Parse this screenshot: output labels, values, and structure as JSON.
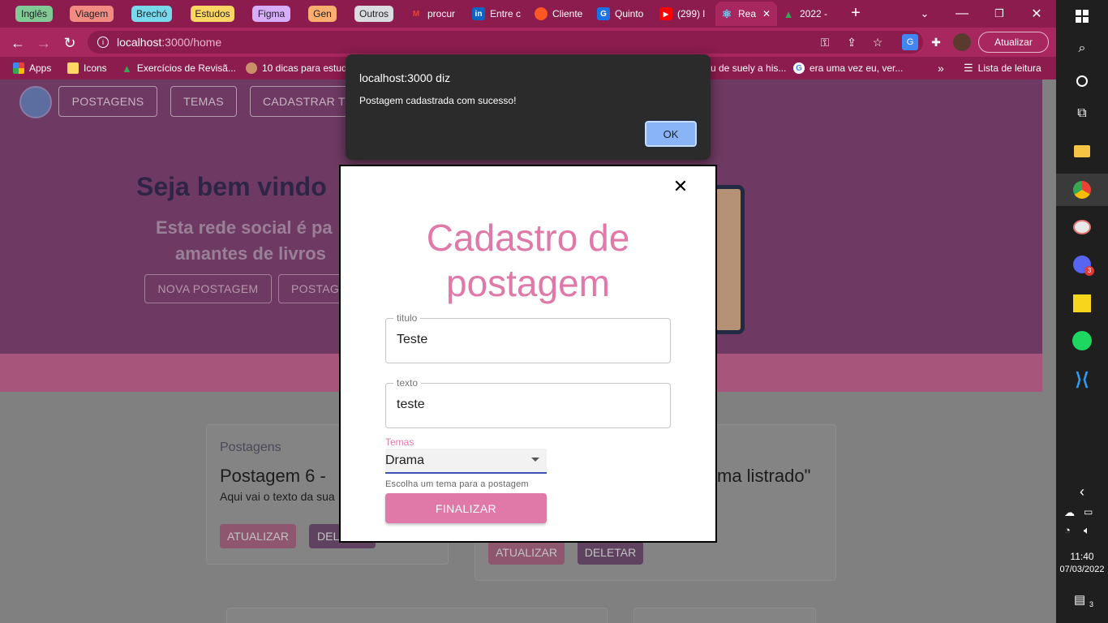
{
  "browser": {
    "tab_groups": [
      {
        "label": "Inglês",
        "color": "#81c995"
      },
      {
        "label": "Viagem",
        "color": "#f28b82"
      },
      {
        "label": "Brechó",
        "color": "#78d9ec"
      },
      {
        "label": "Estudos",
        "color": "#fdd663"
      },
      {
        "label": "Figma",
        "color": "#d7aefb"
      },
      {
        "label": "Gen",
        "color": "#fcad70"
      },
      {
        "label": "Outros",
        "color": "#dadce0"
      }
    ],
    "tabs": [
      {
        "title": "procur",
        "icon": "gmail-icon",
        "color": "#ea4335",
        "glyph": "M"
      },
      {
        "title": "Entre c",
        "icon": "linkedin-icon",
        "color": "#0a66c2",
        "glyph": "in"
      },
      {
        "title": "Cliente",
        "icon": "app-icon",
        "color": "#ff5722",
        "glyph": "●"
      },
      {
        "title": "Quinto",
        "icon": "google-icon",
        "color": "#1a73e8",
        "glyph": "G"
      },
      {
        "title": "(299) l",
        "icon": "youtube-icon",
        "color": "#ff0000",
        "glyph": "▶"
      },
      {
        "title": "Rea",
        "icon": "react-icon",
        "color": "#61dafb",
        "glyph": "⚛"
      },
      {
        "title": "2022 -",
        "icon": "drive-icon",
        "color": "#34a853",
        "glyph": "▲"
      }
    ],
    "url_host": "localhost",
    "url_path": ":3000/home",
    "update_label": "Atualizar",
    "bookmarks": [
      {
        "label": "Apps",
        "icon": "apps-grid-icon",
        "color": "#f4b400"
      },
      {
        "label": "Icons",
        "icon": "folder-icon",
        "color": "#fdd663"
      },
      {
        "label": "Exercícios de Revisã...",
        "icon": "drive-icon",
        "color": "#34a853"
      },
      {
        "label": "10 dicas para estud",
        "icon": "avatar-icon",
        "color": "#c98f6b"
      },
      {
        "label": "u de suely a his...",
        "icon": "",
        "color": ""
      },
      {
        "label": "era uma vez eu, ver...",
        "icon": "google-icon",
        "color": "#ffffff"
      }
    ],
    "reading_list": "Lista de leitura",
    "more_glyph": "»"
  },
  "site": {
    "nav": [
      "POSTAGENS",
      "TEMAS",
      "CADASTRAR T"
    ],
    "welcome": "Seja bem vindo",
    "tagline_line1": "Esta rede social é pa",
    "tagline_line2": "amantes de livros",
    "new_post": "NOVA POSTAGEM",
    "posts_button": "POSTAG",
    "card1": {
      "section": "Postagens",
      "title": "Postagem 6 -",
      "text": "Aqui vai o texto da sua",
      "update": "ATUALIZAR",
      "delete": "DEL"
    },
    "card2": {
      "title": "ma listrado\"",
      "update": "ATUALIZAR",
      "delete": "DELETAR"
    }
  },
  "alert": {
    "origin": "localhost:3000 diz",
    "message": "Postagem cadastrada com sucesso!",
    "ok": "OK"
  },
  "modal": {
    "title_line1": "Cadastro de",
    "title_line2": "postagem",
    "title_field": {
      "label": "titulo",
      "value": "Teste"
    },
    "text_field": {
      "label": "texto",
      "value": "teste"
    },
    "theme_select": {
      "label": "Temas",
      "value": "Drama",
      "helper": "Escolha um tema para a postagem"
    },
    "submit": "FINALIZAR",
    "close_glyph": "✕"
  },
  "taskbar": {
    "time": "11:40",
    "date": "07/03/2022",
    "notification_count": "3",
    "discord_badge": "3"
  },
  "colors": {
    "pink_accent": "#e078a8",
    "chrome_dark": "#8b1c4d",
    "chrome_light": "#a8275f",
    "hero": "#6e3a63"
  }
}
